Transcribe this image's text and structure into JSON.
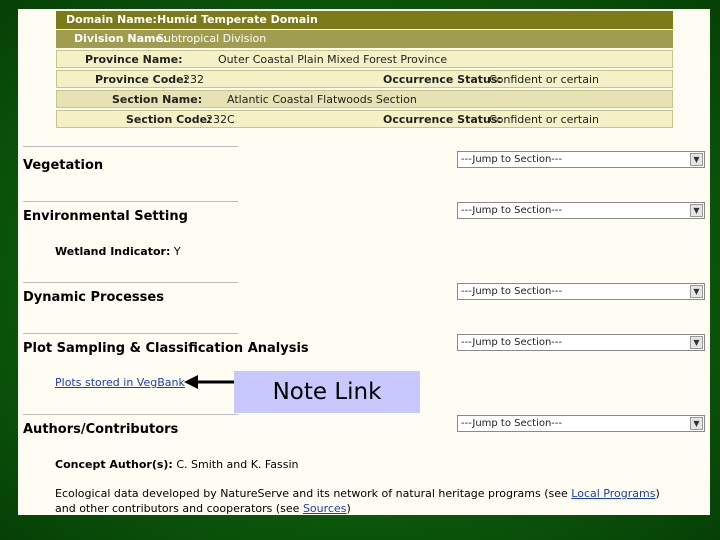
{
  "hierarchy": {
    "domain_label": "Domain Name:",
    "domain_value": "Humid Temperate Domain",
    "division_label": "Division Name:",
    "division_value": "Subtropical Division",
    "province_label": "Province Name:",
    "province_value": "Outer Coastal Plain Mixed Forest Province",
    "province_code_label": "Province Code:",
    "province_code_value": "232",
    "occurrence_label": "Occurrence Status:",
    "occurrence_value": "Confident or certain",
    "section_label": "Section Name:",
    "section_value": "Atlantic Coastal Flatwoods Section",
    "section_code_label": "Section Code:",
    "section_code_value": "232C",
    "occurrence2_label": "Occurrence Status:",
    "occurrence2_value": "Confident or certain"
  },
  "jump_placeholder": "---Jump to Section---",
  "sections": {
    "vegetation": "Vegetation",
    "environmental": "Environmental Setting",
    "dynamic": "Dynamic Processes",
    "plot": "Plot Sampling & Classification Analysis",
    "authors": "Authors/Contributors"
  },
  "wetland": {
    "label": "Wetland Indicator:",
    "value": "Y"
  },
  "plots_link": "Plots stored in VegBank",
  "note_link_label": "Note Link",
  "concept_author": {
    "label": "Concept Author(s):",
    "value": "C. Smith and K. Fassin"
  },
  "footer": {
    "text1": "Ecological data developed by NatureServe and its network of natural heritage programs (see ",
    "link1": "Local Programs",
    "text2": ") and other contributors and cooperators (see ",
    "link2": "Sources",
    "text3": ")"
  }
}
